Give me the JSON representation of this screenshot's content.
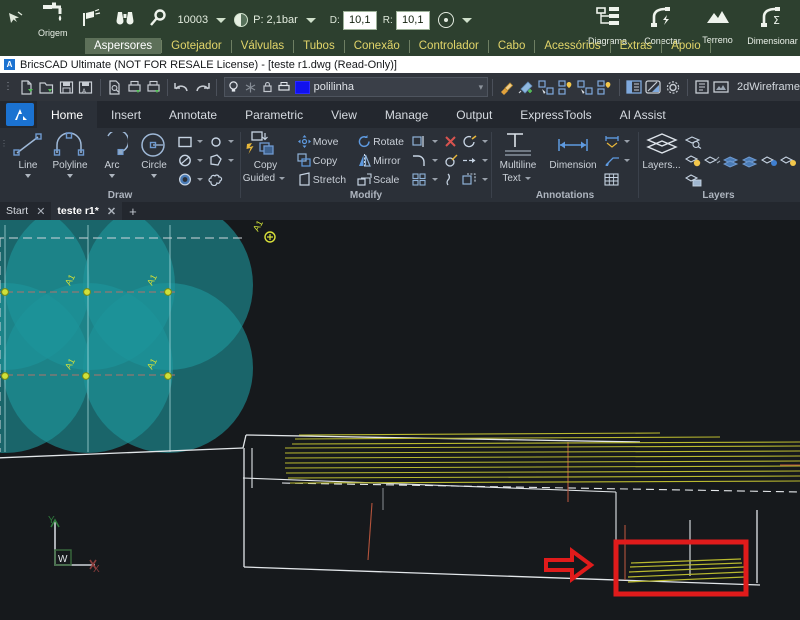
{
  "plugin_bar": {
    "tools": [
      {
        "name": "mouse-pointer-icon",
        "glyph": "↖",
        "label": ""
      },
      {
        "name": "origem-tap-icon",
        "glyph": "⚗",
        "label": "Origem"
      },
      {
        "name": "sprinkler-icon",
        "glyph": "☄",
        "label": ""
      },
      {
        "name": "binoculars-icon",
        "glyph": "♏",
        "label": ""
      },
      {
        "name": "magnifier-icon",
        "glyph": "⚲",
        "label": ""
      }
    ],
    "origem_label": "Origem",
    "flow_value": "10003",
    "pressure_value": "P: 2,1bar",
    "d_label": "D:",
    "d_value": "10,1",
    "r_label": "R:",
    "r_value": "10,1",
    "right_buttons": [
      {
        "name": "diagrama-button",
        "label": "Diagrama"
      },
      {
        "name": "conectar-button",
        "label": "Conectar"
      },
      {
        "name": "terreno-button",
        "label": "Terreno"
      },
      {
        "name": "dimensionar-button",
        "label": "Dimensionar"
      }
    ],
    "tabs": [
      {
        "label": "Aspersores",
        "active": true
      },
      {
        "label": "Gotejador",
        "active": false
      },
      {
        "label": "Válvulas",
        "active": false
      },
      {
        "label": "Tubos",
        "active": false
      },
      {
        "label": "Conexão",
        "active": false
      },
      {
        "label": "Controlador",
        "active": false
      },
      {
        "label": "Cabo",
        "active": false
      },
      {
        "label": "Acessórios",
        "active": false
      },
      {
        "label": "Extras",
        "active": false
      },
      {
        "label": "Apoio",
        "active": false
      }
    ]
  },
  "titlebar": {
    "app_icon": "A",
    "text": "BricsCAD Ultimate (NOT FOR RESALE License) - [teste r1.dwg (Read-Only)]"
  },
  "quick_access": {
    "buttons": [
      {
        "name": "new-file-button",
        "glyph": "🗋"
      },
      {
        "name": "open-file-button",
        "glyph": "📂"
      },
      {
        "name": "save-button",
        "glyph": "💾"
      },
      {
        "name": "save-as-button",
        "glyph": "💾"
      },
      {
        "name": "print-preview-button",
        "glyph": "🔍"
      },
      {
        "name": "plot-settings-button",
        "glyph": "🖨"
      },
      {
        "name": "print-button",
        "glyph": "🖨"
      },
      {
        "name": "undo-button",
        "glyph": "↶"
      },
      {
        "name": "redo-button",
        "glyph": "↷"
      }
    ],
    "layer": {
      "on_icon": "💡",
      "freeze_icon": "❆",
      "lock_icon": "🔓",
      "plot_icon": "🖨",
      "color_hex": "#1111ee",
      "name": "polilinha",
      "caret": "▾"
    },
    "right_buttons": [
      {
        "name": "match-properties-icon",
        "glyph": "🖌"
      },
      {
        "name": "pick-color-icon",
        "glyph": "✒"
      },
      {
        "name": "select-similar-icon",
        "glyph": "⧉"
      },
      {
        "name": "highlight-selection-icon",
        "glyph": "▣"
      },
      {
        "name": "quick-select-icon",
        "glyph": "❖"
      },
      {
        "name": "select-all-icon",
        "glyph": "▦"
      },
      {
        "name": "properties-panel-icon",
        "glyph": "☰"
      },
      {
        "name": "clean-screen-icon",
        "glyph": "◫"
      },
      {
        "name": "settings-gear-icon",
        "glyph": "⚙"
      },
      {
        "name": "command-list-icon",
        "glyph": "≡"
      },
      {
        "name": "render-preview-icon",
        "glyph": "❑"
      }
    ],
    "visual_style": "2dWireframe"
  },
  "ribbon_tabs": [
    {
      "label": "Home",
      "active": true
    },
    {
      "label": "Insert",
      "active": false
    },
    {
      "label": "Annotate",
      "active": false
    },
    {
      "label": "Parametric",
      "active": false
    },
    {
      "label": "View",
      "active": false
    },
    {
      "label": "Manage",
      "active": false
    },
    {
      "label": "Output",
      "active": false
    },
    {
      "label": "ExpressTools",
      "active": false
    },
    {
      "label": "AI Assist",
      "active": false
    }
  ],
  "ribbon": {
    "draw": {
      "title": "Draw",
      "tools": [
        {
          "name": "line-tool",
          "label": "Line"
        },
        {
          "name": "polyline-tool",
          "label": "Polyline"
        },
        {
          "name": "arc-tool",
          "label": "Arc"
        },
        {
          "name": "circle-tool",
          "label": "Circle"
        }
      ],
      "small_icons": [
        {
          "name": "rectangle-tool",
          "glyph": "▭"
        },
        {
          "name": "point-tool",
          "glyph": "○"
        },
        {
          "name": "ellipse-tool",
          "glyph": "⊘"
        },
        {
          "name": "polygon-tool",
          "glyph": "⬠"
        },
        {
          "name": "hatch-tool",
          "glyph": "◉"
        },
        {
          "name": "revcloud-tool",
          "glyph": "☁"
        }
      ]
    },
    "modify": {
      "title": "Modify",
      "copy_guided_label": "Copy\nGuided",
      "copy_guided_line1": "Copy",
      "copy_guided_line2": "Guided",
      "items": [
        {
          "name": "move-tool",
          "label": "Move",
          "glyph": "✥"
        },
        {
          "name": "copy-tool",
          "label": "Copy",
          "glyph": "⧉"
        },
        {
          "name": "stretch-tool",
          "label": "Stretch",
          "glyph": "◧"
        },
        {
          "name": "rotate-tool",
          "label": "Rotate",
          "glyph": "↻"
        },
        {
          "name": "mirror-tool",
          "label": "Mirror",
          "glyph": "△"
        },
        {
          "name": "scale-tool",
          "label": "Scale",
          "glyph": "⤡"
        }
      ],
      "small_icons": [
        {
          "name": "trim-tool",
          "glyph": "⌲"
        },
        {
          "name": "erase-tool",
          "glyph": "✕"
        },
        {
          "name": "explode-tool",
          "glyph": "☇"
        },
        {
          "name": "fillet-tool",
          "glyph": "◜"
        },
        {
          "name": "chamfer-tool",
          "glyph": "⌖"
        },
        {
          "name": "lengthen-tool",
          "glyph": "↔"
        },
        {
          "name": "array-tool",
          "glyph": "▦"
        },
        {
          "name": "offset-tool",
          "glyph": "◔"
        },
        {
          "name": "align-tool",
          "glyph": "⧉"
        }
      ]
    },
    "annotations": {
      "title": "Annotations",
      "multiline_text_line1": "Multiline",
      "multiline_text_line2": "Text",
      "dimension_label": "Dimension",
      "small_icons": [
        {
          "name": "dimension-style-icon",
          "glyph": "⇔"
        },
        {
          "name": "leader-icon",
          "glyph": "↗"
        },
        {
          "name": "table-icon",
          "glyph": "▦"
        }
      ]
    },
    "layers": {
      "title": "Layers",
      "layers_label": "Layers...",
      "small_icons": [
        {
          "name": "layer-states-icon",
          "glyph": "≣"
        },
        {
          "name": "layer-isolate-icon",
          "glyph": "≣"
        },
        {
          "name": "layer-off-icon",
          "glyph": "≣"
        },
        {
          "name": "layer-freeze-icon",
          "glyph": "≣"
        },
        {
          "name": "layer-lock-icon",
          "glyph": "≣"
        },
        {
          "name": "layer-unlock-icon",
          "glyph": "≣"
        },
        {
          "name": "layer-merge-icon",
          "glyph": "≣"
        },
        {
          "name": "layer-previous-icon",
          "glyph": "≣"
        }
      ]
    }
  },
  "doc_tabs": [
    {
      "label": "Start",
      "active": false,
      "close": "✕"
    },
    {
      "label": "teste r1*",
      "active": true,
      "close": "✕"
    }
  ],
  "new_tab_glyph": "+",
  "canvas": {
    "background_hex": "#16191c",
    "sprinkler_coverage_hex": "#1fa6ab",
    "hatch_hex": "#b5b52a",
    "outline_hex": "#d8dce0",
    "pipe_hex": "#b05a3a",
    "annotation_hex": "#e01b1b",
    "sprinkler_labels": [
      "A1",
      "A1",
      "A1",
      "A1",
      "A1"
    ],
    "ucs": {
      "x_label": "X",
      "y_label": "Y",
      "origin_label": "W"
    }
  }
}
